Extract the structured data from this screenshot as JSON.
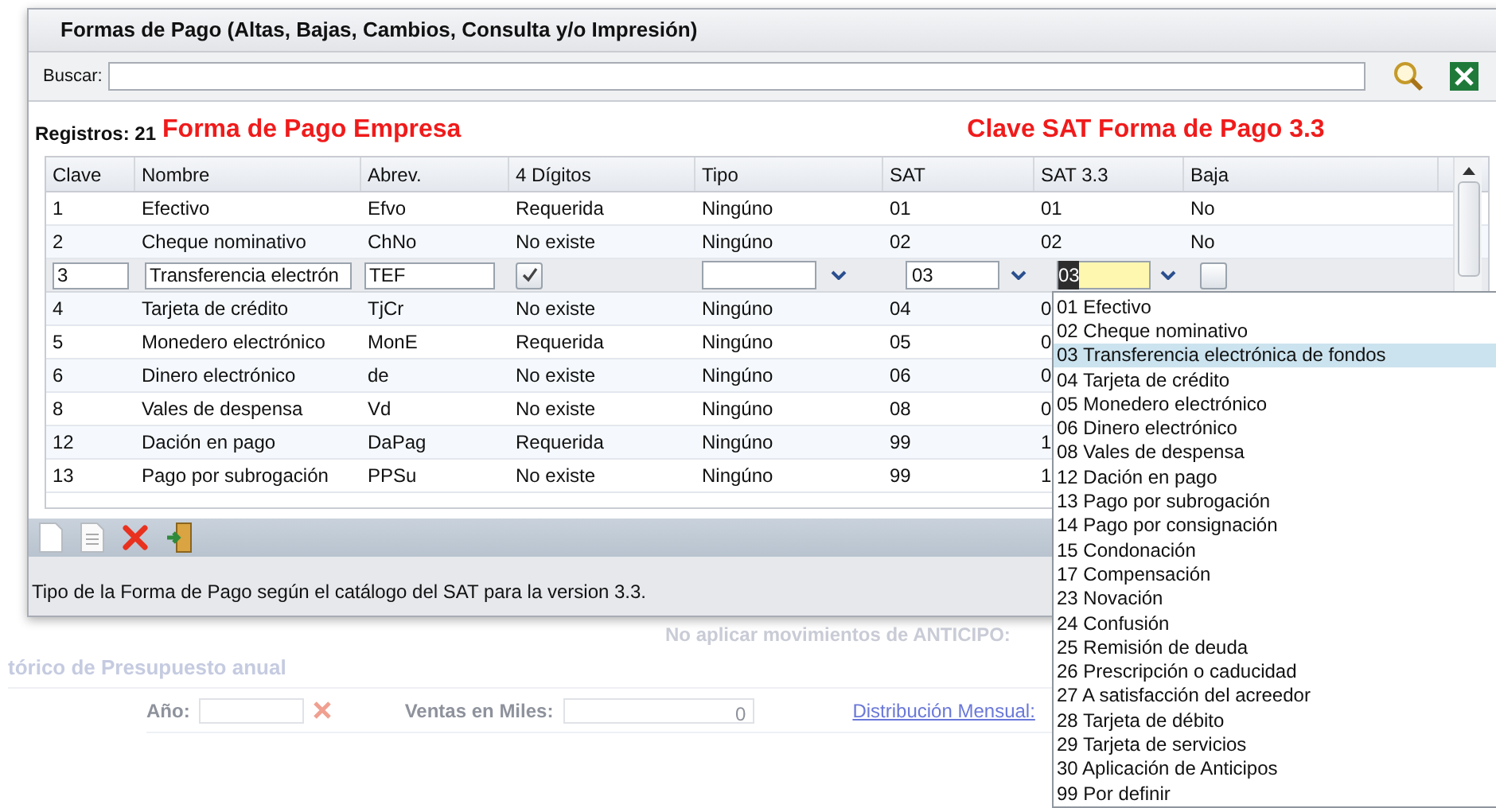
{
  "dialog": {
    "title": "Formas de Pago (Altas, Bajas, Cambios, Consulta y/o Impresión)",
    "search": {
      "label": "Buscar:"
    },
    "records": "Registros: 21",
    "annotations": [
      "Forma de Pago Empresa",
      "Clave SAT Forma de Pago 3.3"
    ],
    "table": {
      "columns": [
        "Clave",
        "Nombre",
        "Abrev.",
        "4 Dígitos",
        "Tipo",
        "SAT",
        "SAT 3.3",
        "Baja"
      ],
      "rows": [
        {
          "kind": "data",
          "cells": [
            "1",
            "Efectivo",
            "Efvo",
            "Requerida",
            "Ningúno",
            "01",
            "01",
            "No"
          ]
        },
        {
          "kind": "data",
          "cells": [
            "2",
            "Cheque nominativo",
            "ChNo",
            "No existe",
            "Ningúno",
            "02",
            "02",
            "No"
          ]
        },
        {
          "kind": "edit",
          "clave": "3",
          "nombre": "Transferencia electrón",
          "abrev": "TEF",
          "digitos_checked": true,
          "tipo": "",
          "sat": "03",
          "sat33": "03",
          "baja_checked": false
        },
        {
          "kind": "data",
          "cells": [
            "4",
            "Tarjeta de crédito",
            "TjCr",
            "No existe",
            "Ningúno",
            "04",
            "0"
          ]
        },
        {
          "kind": "data",
          "cells": [
            "5",
            "Monedero electrónico",
            "MonE",
            "Requerida",
            "Ningúno",
            "05",
            "0"
          ]
        },
        {
          "kind": "data",
          "cells": [
            "6",
            "Dinero electrónico",
            "de",
            "No existe",
            "Ningúno",
            "06",
            "0"
          ]
        },
        {
          "kind": "data",
          "cells": [
            "8",
            "Vales de despensa",
            "Vd",
            "No existe",
            "Ningúno",
            "08",
            "0"
          ]
        },
        {
          "kind": "data",
          "cells": [
            "12",
            "Dación en pago",
            "DaPag",
            "Requerida",
            "Ningúno",
            "99",
            "1"
          ]
        },
        {
          "kind": "data",
          "cells": [
            "13",
            "Pago por subrogación",
            "PPSu",
            "No existe",
            "Ningúno",
            "99",
            "1"
          ]
        }
      ]
    },
    "status": "Tipo de la Forma de Pago según el catálogo del SAT para la version 3.3."
  },
  "dropdown": {
    "options": [
      {
        "label": "01 Efectivo",
        "selected": false
      },
      {
        "label": "02 Cheque nominativo",
        "selected": false
      },
      {
        "label": "03 Transferencia electrónica de fondos",
        "selected": true
      },
      {
        "label": "04 Tarjeta de crédito",
        "selected": false
      },
      {
        "label": "05 Monedero electrónico",
        "selected": false
      },
      {
        "label": "06 Dinero electrónico",
        "selected": false
      },
      {
        "label": "08 Vales de despensa",
        "selected": false
      },
      {
        "label": "12 Dación en pago",
        "selected": false
      },
      {
        "label": "13 Pago por subrogación",
        "selected": false
      },
      {
        "label": "14 Pago por consignación",
        "selected": false
      },
      {
        "label": "15 Condonación",
        "selected": false
      },
      {
        "label": "17 Compensación",
        "selected": false
      },
      {
        "label": "23 Novación",
        "selected": false
      },
      {
        "label": "24 Confusión",
        "selected": false
      },
      {
        "label": "25 Remisión de deuda",
        "selected": false
      },
      {
        "label": "26 Prescripción o caducidad",
        "selected": false
      },
      {
        "label": "27 A satisfacción del acreedor",
        "selected": false
      },
      {
        "label": "28 Tarjeta de débito",
        "selected": false
      },
      {
        "label": "29 Tarjeta de servicios",
        "selected": false
      },
      {
        "label": "30 Aplicación de Anticipos",
        "selected": false
      },
      {
        "label": "99 Por definir",
        "selected": false
      }
    ]
  },
  "background": {
    "anticipo_label": "No aplicar movimientos de ANTICIPO:",
    "section_title": "tórico de Presupuesto anual",
    "year_label": "Año:",
    "sales_label": "Ventas en Miles:",
    "sales_value": "0",
    "distribution_link": "Distribución Mensual:"
  }
}
